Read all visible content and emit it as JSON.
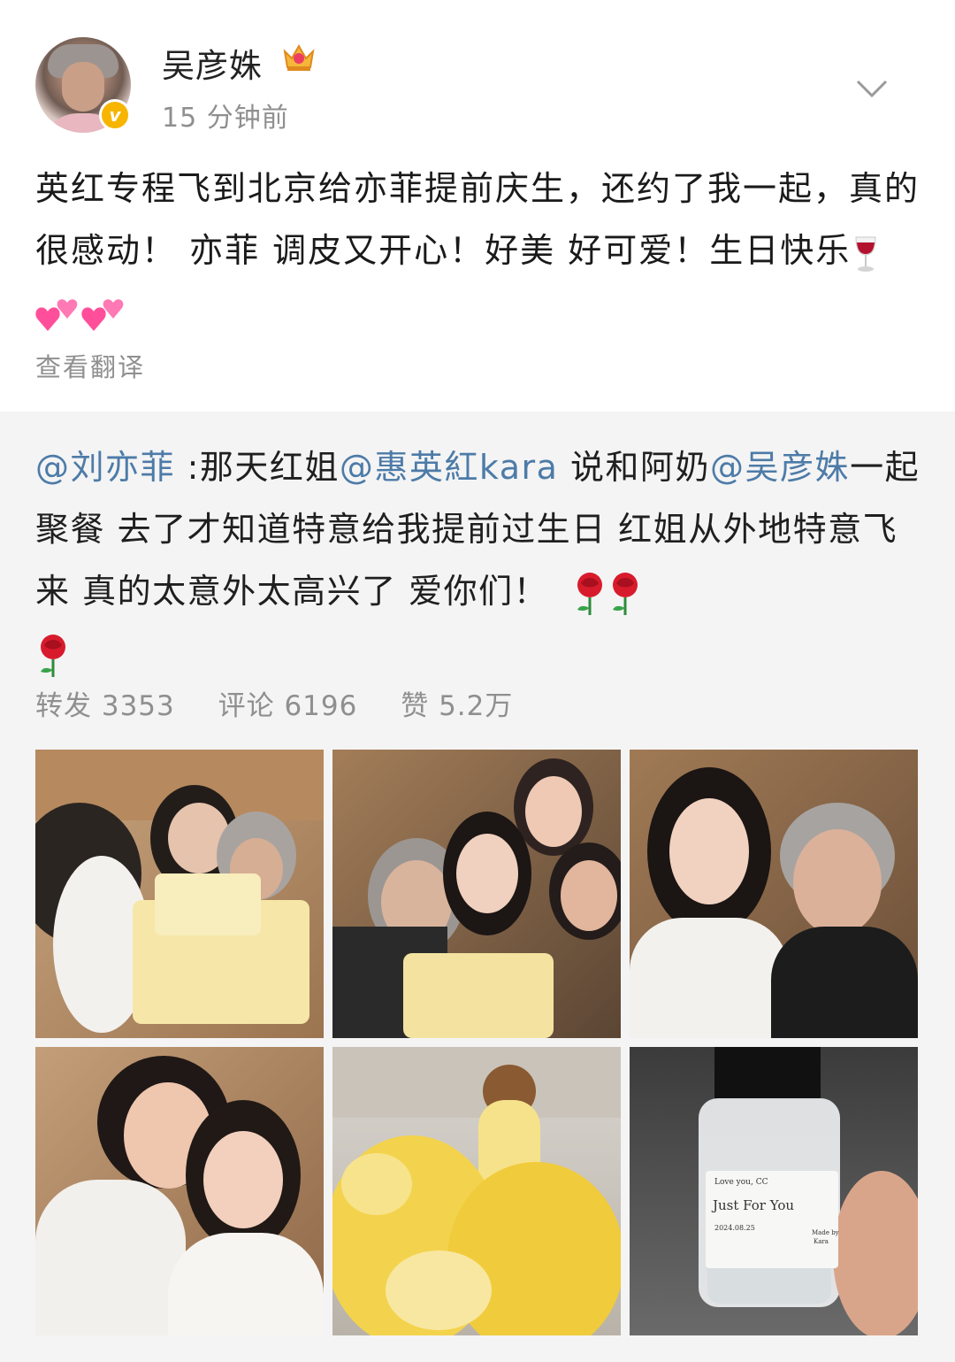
{
  "post": {
    "username": "吴彦姝",
    "time": "15 分钟前",
    "content": "英红专程飞到北京给亦菲提前庆生，还约了我一起，真的很感动！ 亦菲 调皮又开心！好美 好可爱！生日快乐",
    "translate_label": "查看翻译"
  },
  "repost": {
    "mention_1": "@刘亦菲",
    "text_1": " :那天红姐",
    "mention_2": "@惠英紅kara",
    "text_2": " 说和阿奶",
    "mention_3": "@吴彦姝",
    "text_3": "一起聚餐 去了才知道特意给我提前过生日 红姐从外地特意飞来 真的太意外太高兴了 爱你们！",
    "stats": {
      "repost": "转发 3353",
      "comment": "评论 6196",
      "like": "赞 5.2万"
    },
    "bottle_text": {
      "line1": "Love you, CC",
      "line2": "Just For You",
      "date": "2024.08.25",
      "made_by": "Made by",
      "maker": "Kara"
    }
  },
  "icons": {
    "verified": "verified-badge-icon",
    "crown": "crown-icon",
    "more": "chevron-down-icon",
    "wine": "wine-glass-icon",
    "hearts": "two-hearts-icon",
    "rose": "rose-icon"
  },
  "colors": {
    "mention": "#4d7ba8",
    "secondary": "#8f8f8f",
    "repost_bg": "#f4f4f4",
    "badge": "#f7b500"
  }
}
